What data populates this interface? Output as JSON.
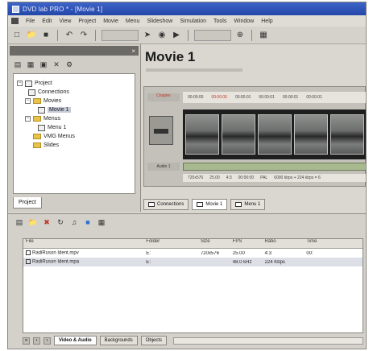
{
  "window": {
    "title": "DVD lab PRO * - [Movie 1]"
  },
  "menu": [
    "File",
    "Edit",
    "View",
    "Project",
    "Movie",
    "Menu",
    "Slideshow",
    "Simulation",
    "Tools",
    "Window",
    "Help"
  ],
  "toolbar": {
    "icons": [
      "new-icon",
      "open-icon",
      "save-icon",
      "undo-icon",
      "redo-icon",
      "select-icon",
      "binoculars-icon",
      "play-icon",
      "zoom-icon",
      "settings-icon"
    ]
  },
  "project_tree": {
    "items": [
      {
        "label": "Project"
      },
      {
        "label": "Connections"
      },
      {
        "label": "Movies"
      },
      {
        "label": "Movie 1"
      },
      {
        "label": "Menus"
      },
      {
        "label": "Menu 1"
      },
      {
        "label": "VMG Menus"
      },
      {
        "label": "Slides"
      }
    ],
    "tab_label": "Project"
  },
  "movie": {
    "title": "Movie 1",
    "track_label": "Chapter",
    "ruler_ticks": [
      "00:00:00",
      "00:00:00",
      "00:00:01",
      "00:00:01",
      "00:00:01",
      "00:00:01"
    ],
    "audio_label": "Audio 1",
    "status": [
      "720x576",
      "25.00",
      "4:3",
      "00:00:00",
      "PAL",
      "6000 kbps + 224 kbps = 6"
    ]
  },
  "doc_tabs": [
    "Connections",
    "Movie 1",
    "Menu 1"
  ],
  "assets": {
    "columns": [
      "File",
      "Folder",
      "Size",
      "FPS",
      "Ratio",
      "Time"
    ],
    "rows": [
      {
        "name": "RadiRuson Ident.mpv",
        "folder": "E:",
        "size": "720x576",
        "fps": "25.00",
        "ratio": "4:3",
        "time": "00:"
      },
      {
        "name": "RadiRuson Ident.mpa",
        "folder": "E:",
        "size": "",
        "fps": "48.0 kHz",
        "ratio": "224 Kbps",
        "time": ""
      }
    ],
    "tabs": [
      "Video & Audio",
      "Backgrounds",
      "Objects"
    ]
  }
}
